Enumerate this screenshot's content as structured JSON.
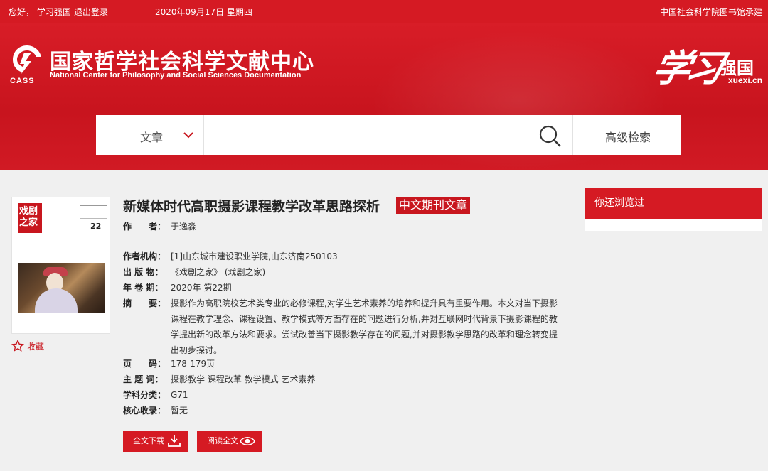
{
  "topbar": {
    "greeting": "您好， 学习强国",
    "logout": "退出登录",
    "date": "2020年09月17日 星期四",
    "undertake": "中国社会科学院图书馆承建"
  },
  "header": {
    "logo_abbr": "CASS",
    "logo_cn": "国家哲学社会科学文献中心",
    "logo_en": "National Center for Philosophy and Social Sciences Documentation",
    "partner_brush": "学习",
    "partner_name": "强国",
    "partner_domain": "xuexi.cn"
  },
  "search": {
    "type_label": "文章",
    "placeholder": "",
    "advanced_label": "高级检索"
  },
  "cover": {
    "journal_name": "戏剧之家",
    "issue_number": "22"
  },
  "favorite_label": "收藏",
  "article": {
    "title": "新媒体时代高职摄影课程教学改革思路探析",
    "tag": "中文期刊文章",
    "fields": [
      {
        "key": "作　　者：",
        "value": "于逸淼"
      },
      {
        "key": "作者机构：",
        "value": "[1]山东城市建设职业学院,山东济南250103"
      },
      {
        "key": "出 版 物：",
        "value": "《戏剧之家》 (戏剧之家)"
      },
      {
        "key": "年 卷 期：",
        "value": "2020年 第22期"
      },
      {
        "key": "摘　　要：",
        "value": "摄影作为高职院校艺术类专业的必修课程,对学生艺术素养的培养和提升具有重要作用。本文对当下摄影课程在教学理念、课程设置、教学模式等方面存在的问题进行分析,并对互联网时代背景下摄影课程的教学提出新的改革方法和要求。尝试改善当下摄影教学存在的问题,并对摄影教学思路的改革和理念转变提出初步探讨。"
      },
      {
        "key": "页　　码：",
        "value": "178-179页"
      },
      {
        "key": "主 题 词：",
        "value": "摄影教学 课程改革 教学模式 艺术素养"
      },
      {
        "key": "学科分类：",
        "value": "G71"
      },
      {
        "key": "核心收录：",
        "value": "暂无"
      }
    ]
  },
  "actions": {
    "download_label": "全文下载",
    "read_label": "阅读全文"
  },
  "sidebar": {
    "recent_title": "你还浏览过"
  },
  "colors": {
    "brand_red": "#d51a23",
    "page_bg": "#f0f0f0"
  }
}
